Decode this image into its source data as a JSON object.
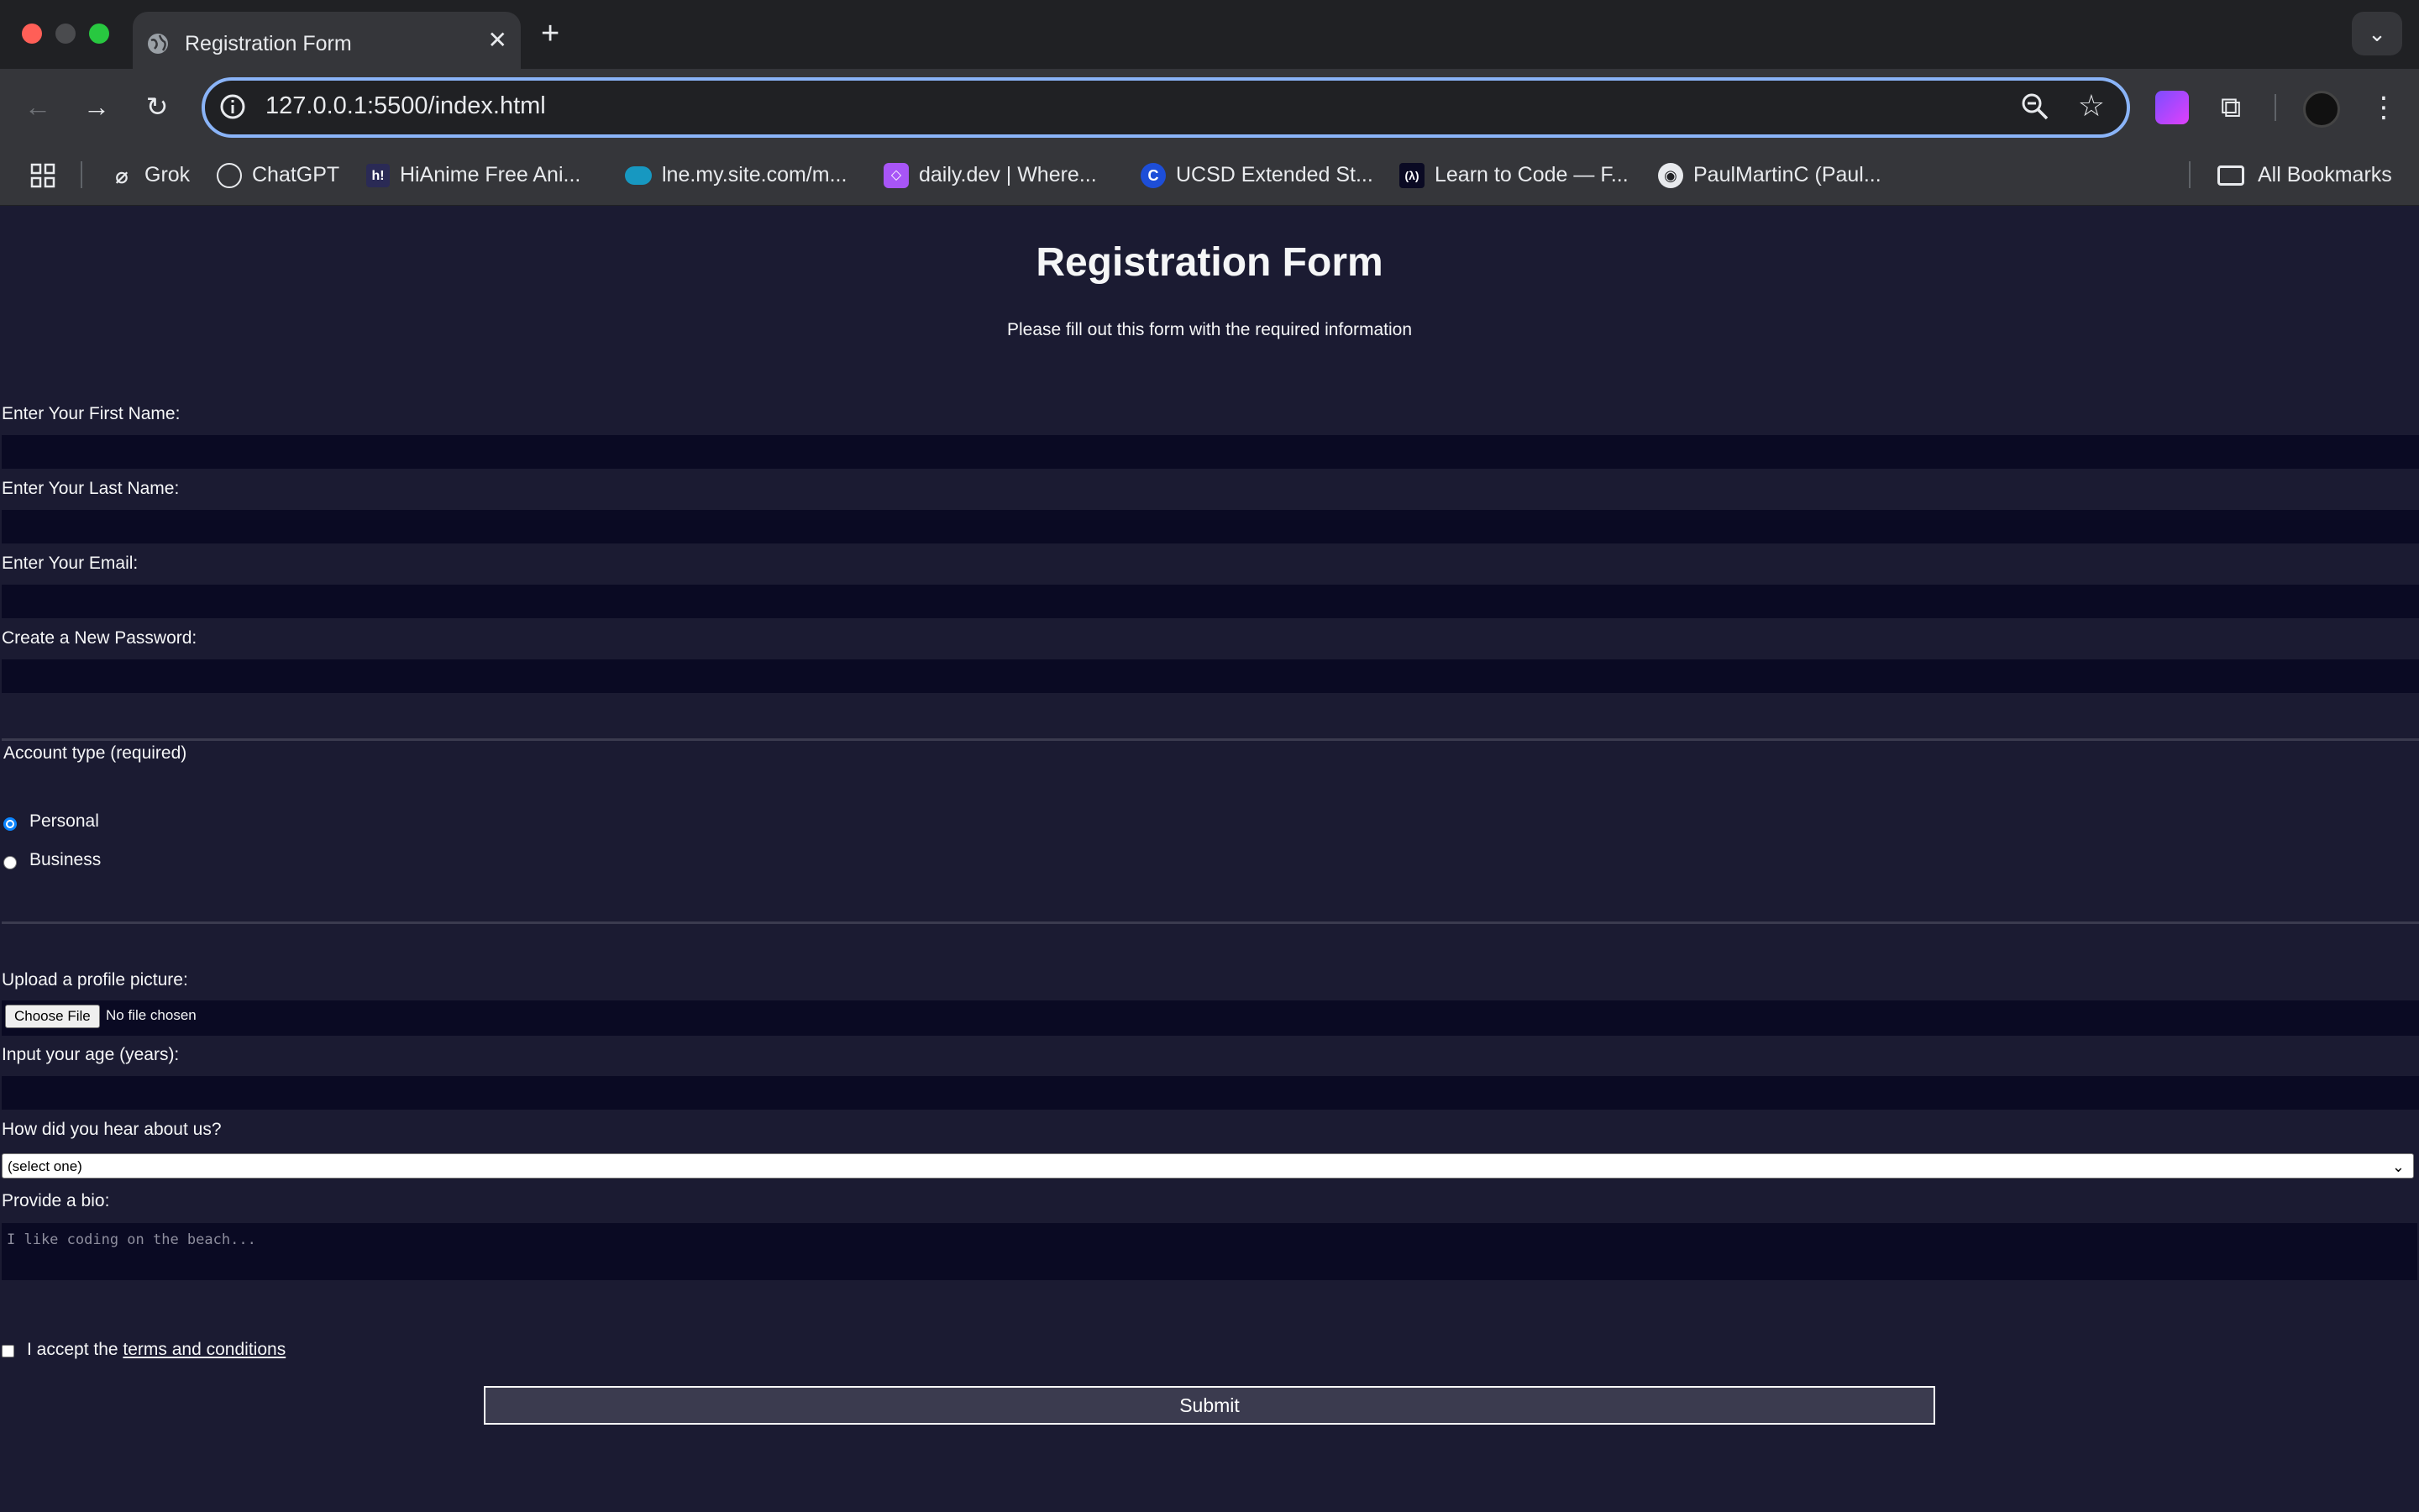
{
  "browser": {
    "tab_title": "Registration Form",
    "tab_close": "✕",
    "new_tab": "+",
    "url": "127.0.0.1:5500/index.html",
    "bookmarks": [
      {
        "label": "Grok",
        "icon": "grok-icon"
      },
      {
        "label": "ChatGPT",
        "icon": "chatgpt-icon"
      },
      {
        "label": "HiAnime Free Ani...",
        "icon": "hianime-icon"
      },
      {
        "label": "lne.my.site.com/m...",
        "icon": "salesforce-cloud-icon"
      },
      {
        "label": "daily.dev | Where...",
        "icon": "dailydev-icon"
      },
      {
        "label": "UCSD Extended St...",
        "icon": "ucsd-icon"
      },
      {
        "label": "Learn to Code — F...",
        "icon": "freecodecamp-icon"
      },
      {
        "label": "PaulMartinC (Paul...",
        "icon": "github-icon"
      }
    ],
    "all_bookmarks": "All Bookmarks"
  },
  "form": {
    "title": "Registration Form",
    "subtitle": "Please fill out this form with the required information",
    "first_name_label": "Enter Your First Name:",
    "last_name_label": "Enter Your Last Name:",
    "email_label": "Enter Your Email:",
    "password_label": "Create a New Password:",
    "account_type_legend": "Account type (required)",
    "account_options": [
      "Personal",
      "Business"
    ],
    "account_selected": "Personal",
    "profile_picture_label": "Upload a profile picture:",
    "file_button": "Choose File",
    "file_status": "No file chosen",
    "age_label": "Input your age (years):",
    "referrer_label": "How did you hear about us?",
    "referrer_selected": "(select one)",
    "bio_label": "Provide a bio:",
    "bio_placeholder": "I like coding on the beach...",
    "terms_prefix": "I accept the",
    "terms_link": "terms and conditions",
    "submit_label": "Submit"
  },
  "colors": {
    "page_background": "#1b1b32",
    "input_background": "#0a0a23",
    "submit_background": "#3b3b4f",
    "focus_ring": "#8ab4f8"
  }
}
